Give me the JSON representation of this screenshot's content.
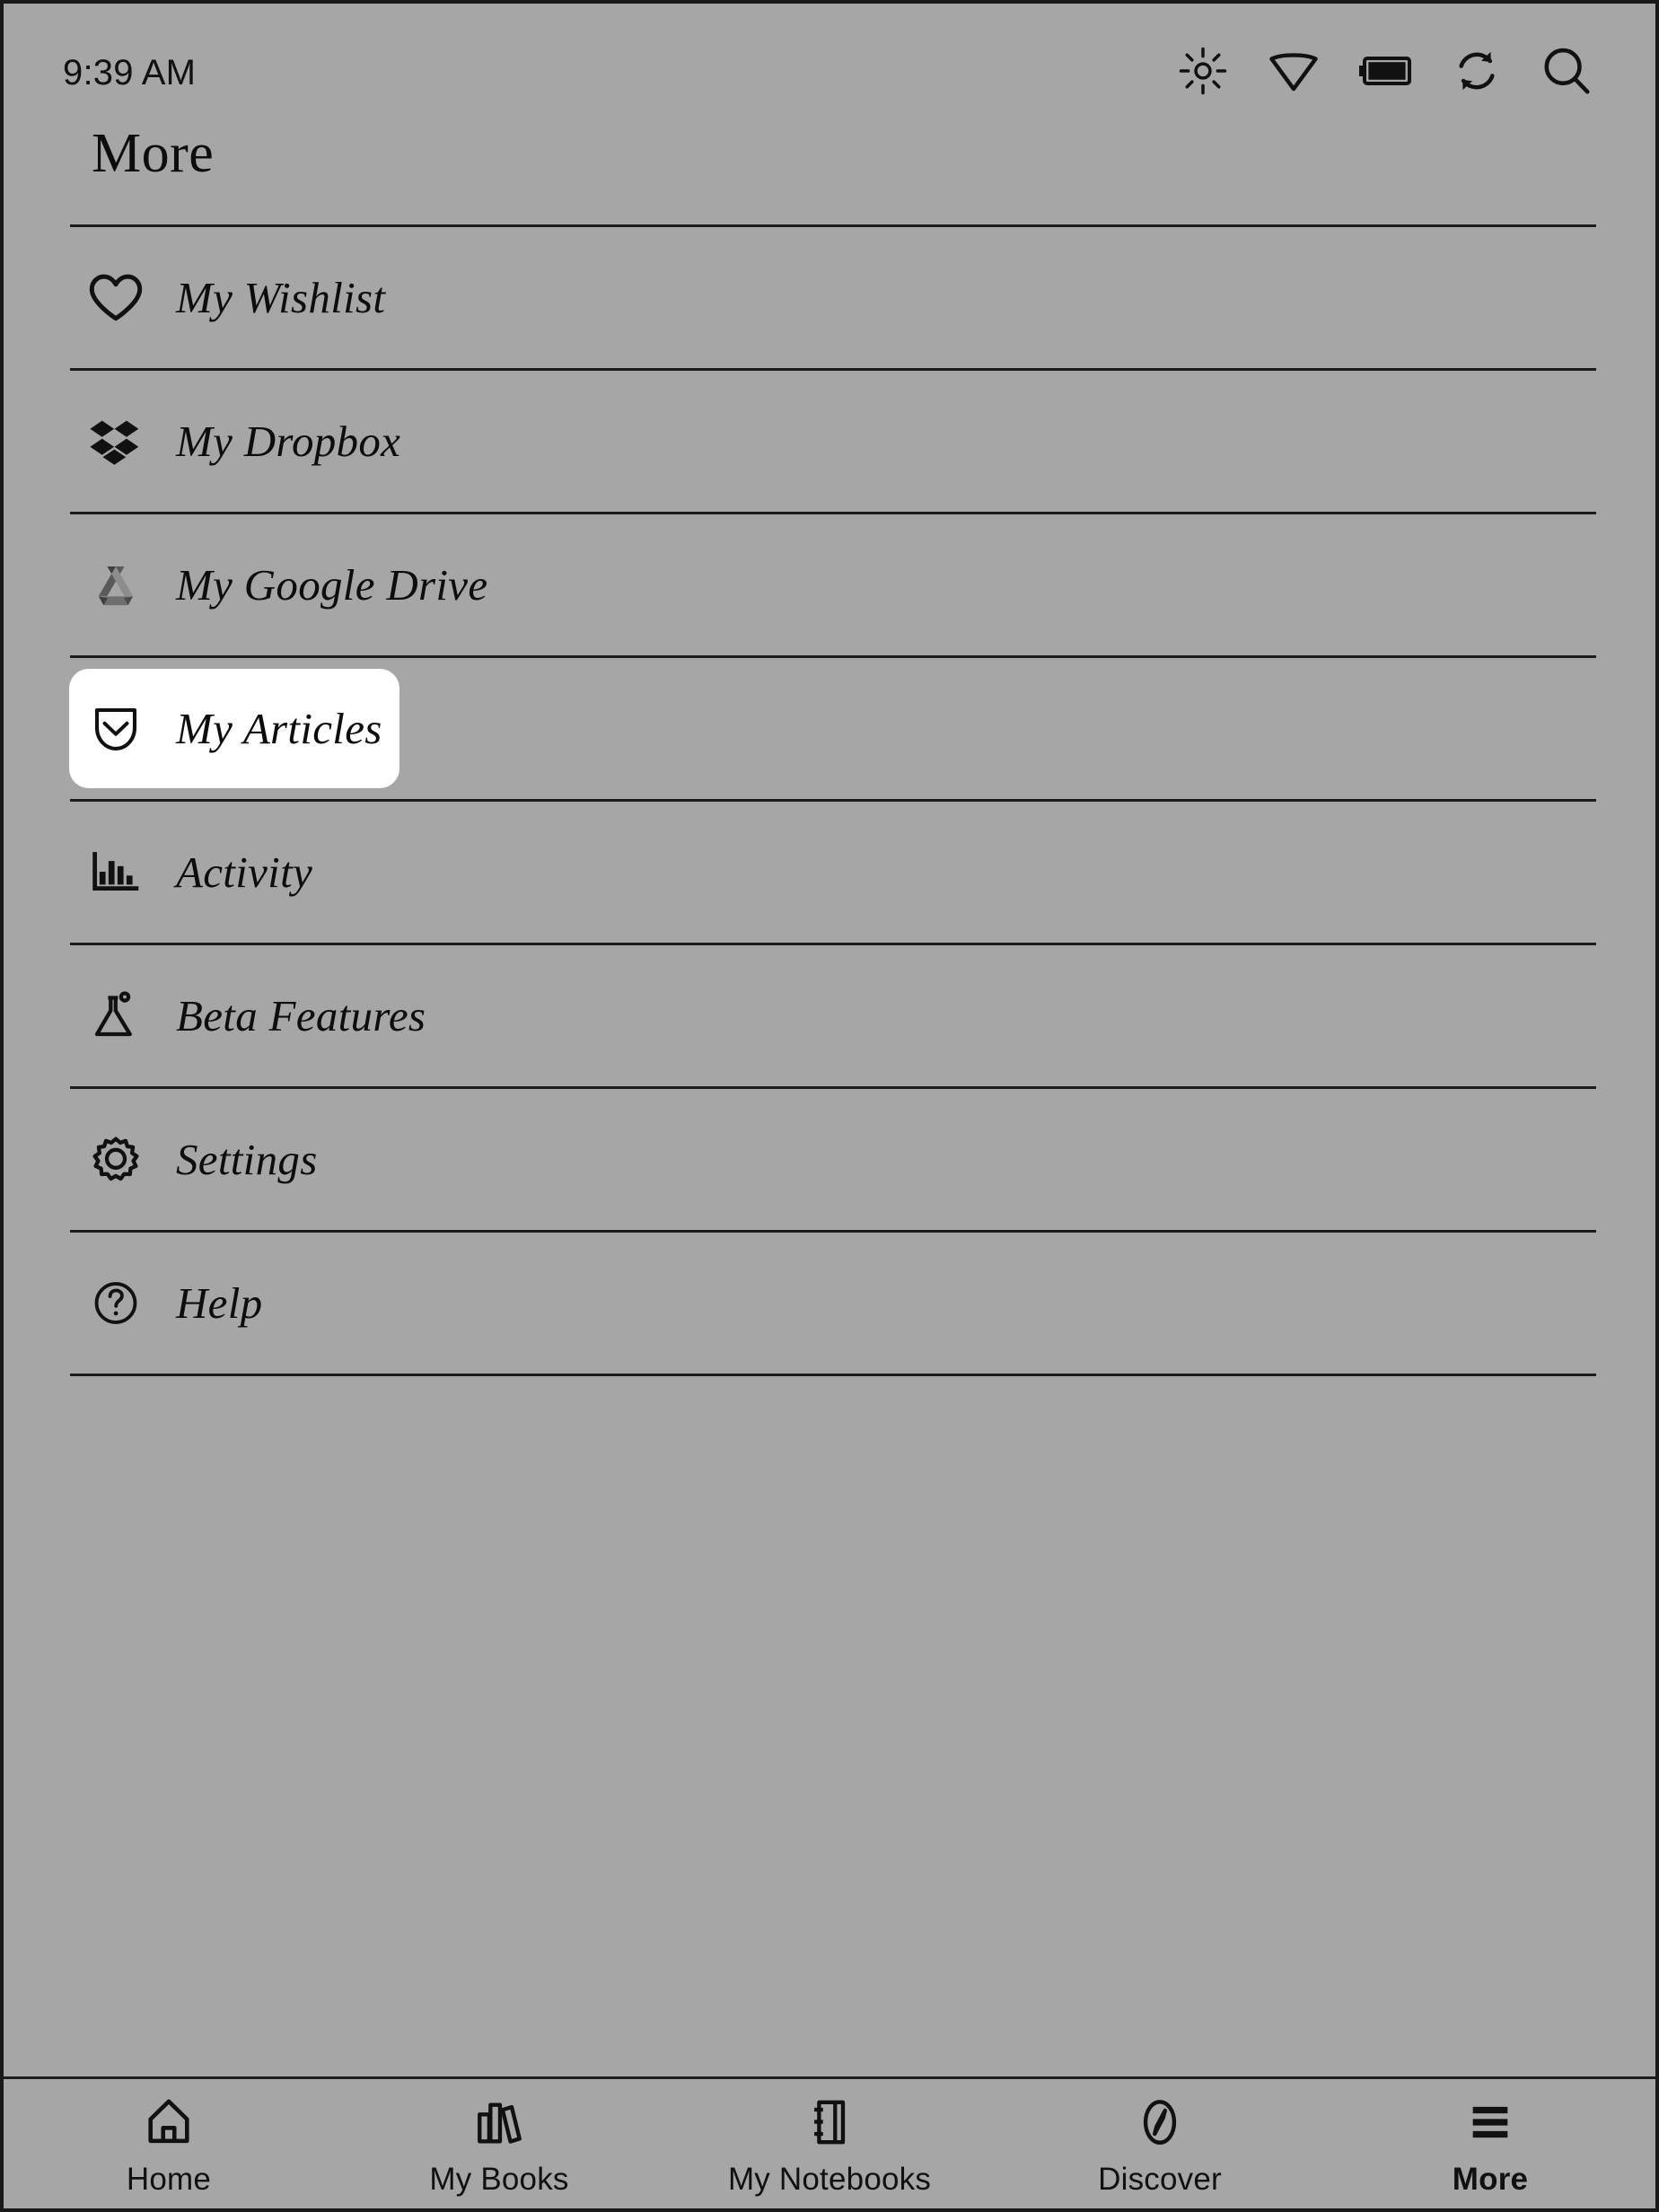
{
  "statusbar": {
    "time": "9:39 AM",
    "icons": [
      {
        "name": "brightness-icon",
        "label": "Brightness"
      },
      {
        "name": "wifi-icon",
        "label": "Wi-Fi"
      },
      {
        "name": "battery-icon",
        "label": "Battery"
      },
      {
        "name": "sync-icon",
        "label": "Sync"
      },
      {
        "name": "search-icon",
        "label": "Search"
      }
    ]
  },
  "header": {
    "title": "More"
  },
  "menu": {
    "items": [
      {
        "label": "My Wishlist",
        "icon": "heart-icon",
        "selected": false
      },
      {
        "label": "My Dropbox",
        "icon": "dropbox-icon",
        "selected": false
      },
      {
        "label": "My Google Drive",
        "icon": "google-drive-icon",
        "selected": false
      },
      {
        "label": "My Articles",
        "icon": "pocket-icon",
        "selected": true
      },
      {
        "label": "Activity",
        "icon": "bar-chart-icon",
        "selected": false
      },
      {
        "label": "Beta Features",
        "icon": "flask-icon",
        "selected": false
      },
      {
        "label": "Settings",
        "icon": "gear-icon",
        "selected": false
      },
      {
        "label": "Help",
        "icon": "question-circle-icon",
        "selected": false
      }
    ]
  },
  "bottom_nav": {
    "items": [
      {
        "label": "Home",
        "icon": "home-icon",
        "active": false
      },
      {
        "label": "My Books",
        "icon": "books-icon",
        "active": false
      },
      {
        "label": "My Notebooks",
        "icon": "notebook-icon",
        "active": false
      },
      {
        "label": "Discover",
        "icon": "compass-icon",
        "active": false
      },
      {
        "label": "More",
        "icon": "hamburger-icon",
        "active": true
      }
    ]
  },
  "colors": {
    "background": "#a6a6a6",
    "foreground": "#0d0d0d",
    "highlight": "#ffffff",
    "separator": "#1c1c1c"
  }
}
